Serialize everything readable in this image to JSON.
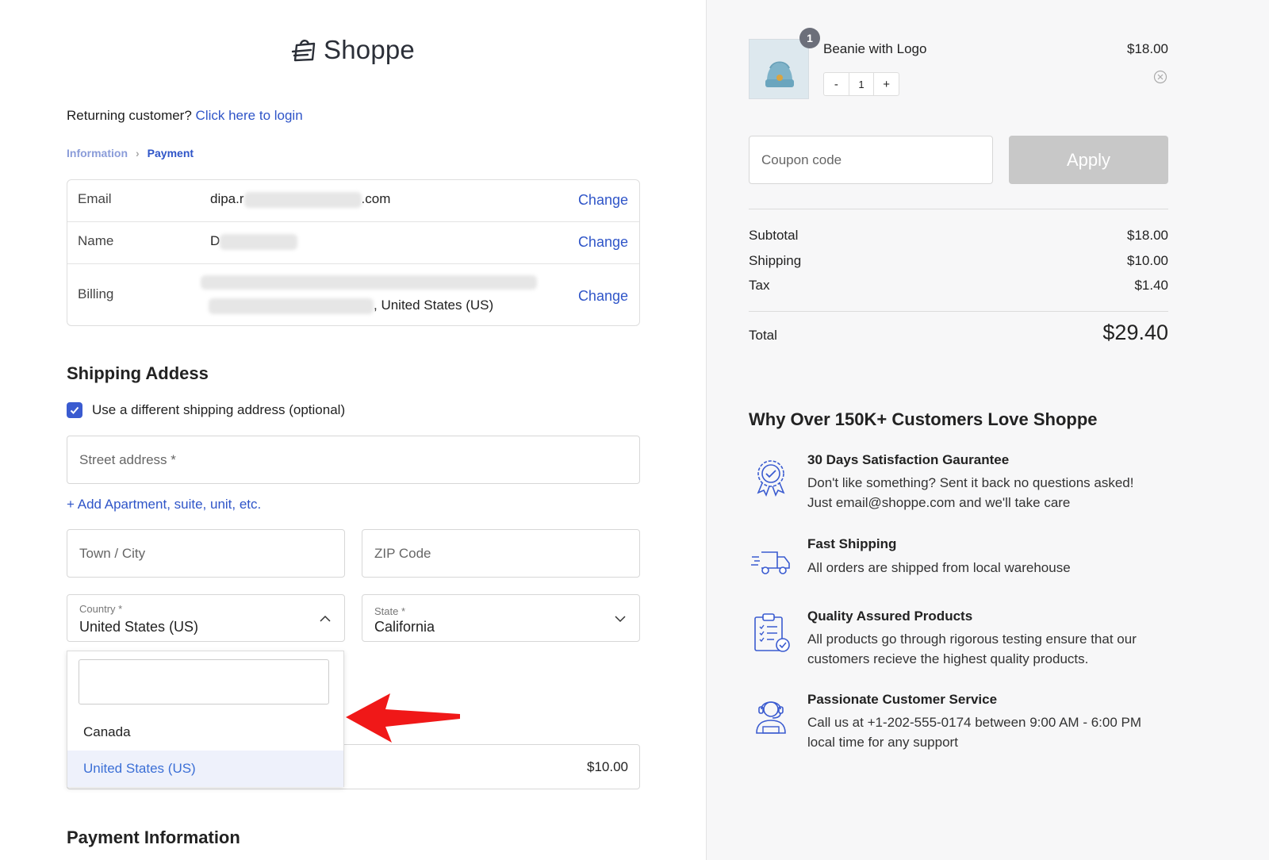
{
  "brand": {
    "name": "Shoppe"
  },
  "returning": {
    "prompt": "Returning customer?",
    "link": "Click here to login"
  },
  "breadcrumb": {
    "step1": "Information",
    "step2": "Payment"
  },
  "summary": {
    "email": {
      "label": "Email",
      "prefix": "dipa.r",
      "suffix": ".com",
      "action": "Change"
    },
    "name": {
      "label": "Name",
      "prefix": "D",
      "action": "Change"
    },
    "billing": {
      "label": "Billing",
      "suffix": ", United States (US)",
      "action": "Change"
    }
  },
  "shipping": {
    "title": "Shipping Addess",
    "checkbox_label": "Use a different shipping address (optional)",
    "street_placeholder": "Street address *",
    "add_apt": "Add Apartment, suite, unit, etc.",
    "city_placeholder": "Town / City",
    "zip_placeholder": "ZIP Code",
    "country_label": "Country *",
    "country_value": "United States (US)",
    "state_label": "State *",
    "state_value": "California",
    "country_options": [
      "Canada",
      "United States (US)"
    ],
    "shipping_cost": "$10.00"
  },
  "payment": {
    "title": "Payment Information"
  },
  "cart": {
    "item": {
      "name": "Beanie with Logo",
      "price": "$18.00",
      "qty": "1",
      "badge": "1",
      "minus": "-",
      "plus": "+"
    },
    "coupon_placeholder": "Coupon code",
    "apply_label": "Apply",
    "totals": {
      "subtotal_label": "Subtotal",
      "subtotal": "$18.00",
      "shipping_label": "Shipping",
      "shipping": "$10.00",
      "tax_label": "Tax",
      "tax": "$1.40",
      "total_label": "Total",
      "total": "$29.40"
    }
  },
  "why": {
    "title": "Why Over 150K+ Customers Love Shoppe",
    "features": [
      {
        "icon": "badge-check-icon",
        "title": "30 Days Satisfaction Gaurantee",
        "line1": "Don't like something? Sent it back no questions asked!",
        "line2": "Just email@shoppe.com and we'll take care"
      },
      {
        "icon": "fast-truck-icon",
        "title": "Fast Shipping",
        "line1": "All orders are shipped from local warehouse",
        "line2": ""
      },
      {
        "icon": "clipboard-check-icon",
        "title": "Quality Assured Products",
        "line1": "All products go through rigorous testing ensure that our",
        "line2": "customers recieve the highest quality products."
      },
      {
        "icon": "headset-agent-icon",
        "title": "Passionate Customer Service",
        "line1": "Call us at +1-202-555-0174 between 9:00 AM - 6:00 PM",
        "line2": "local time for any support"
      }
    ]
  },
  "colors": {
    "accent": "#2f55c8",
    "checkbox": "#3a5bd0",
    "arrow": "#f01818",
    "apply_disabled": "#c8c8c8",
    "sidebar_bg": "#f7f7f8"
  }
}
